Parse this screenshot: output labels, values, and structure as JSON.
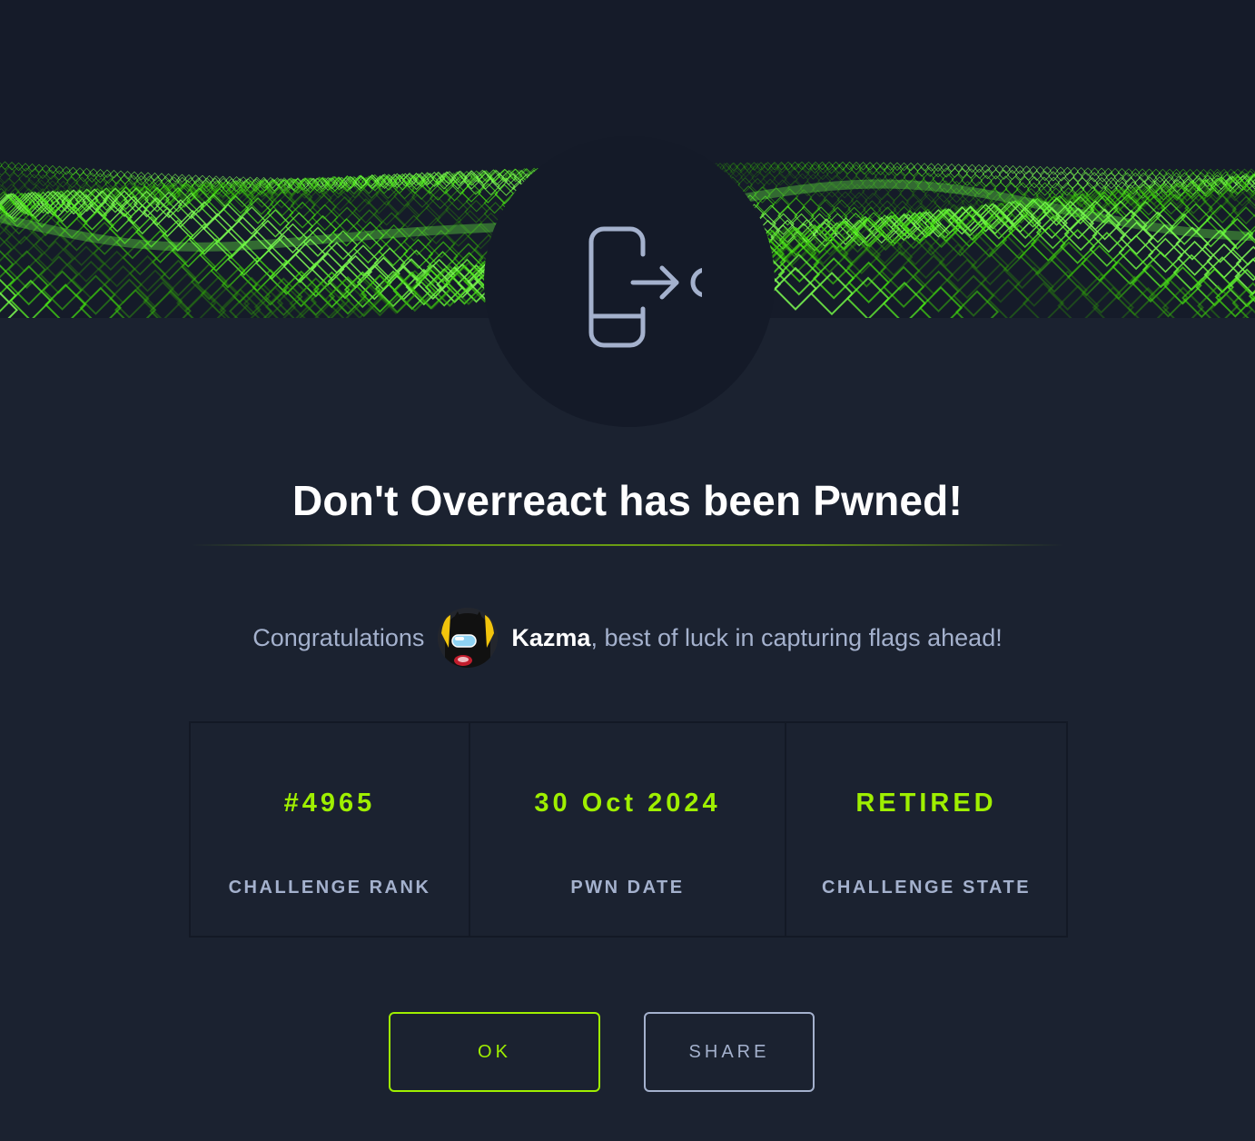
{
  "modal": {
    "title": "Don't Overreact has been Pwned!",
    "challenge_icon": "mobile-exit-icon"
  },
  "congrats": {
    "prefix": "Congratulations",
    "username": "Kazma",
    "suffix": ", best of luck in capturing flags ahead!",
    "avatar_icon": "user-avatar"
  },
  "stats": [
    {
      "value": "#4965",
      "label": "CHALLENGE RANK"
    },
    {
      "value": "30 Oct 2024",
      "label": "PWN DATE"
    },
    {
      "value": "RETIRED",
      "label": "CHALLENGE STATE"
    }
  ],
  "buttons": {
    "ok_label": "OK",
    "share_label": "SHARE"
  },
  "colors": {
    "accent": "#9fef00",
    "background": "#1b2230",
    "text_muted": "#a4b1cd"
  }
}
